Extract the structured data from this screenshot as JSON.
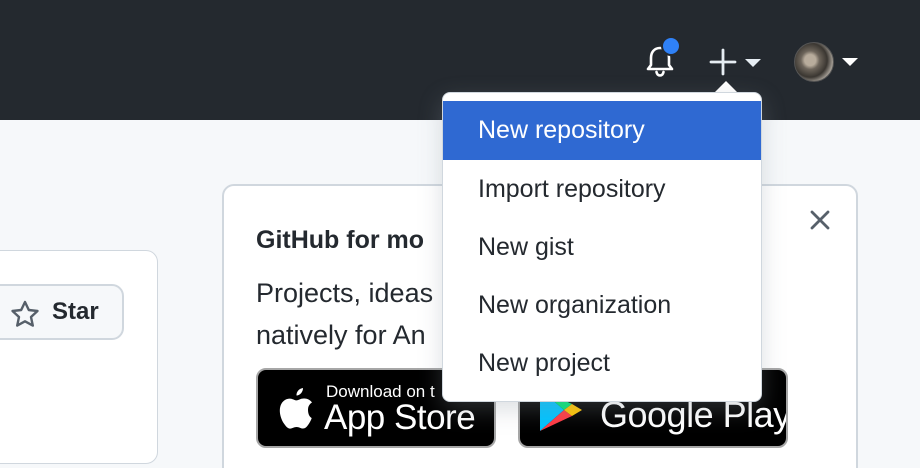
{
  "header": {
    "notifications_icon": "bell-icon",
    "create_icon": "plus-icon",
    "accent_unread_dot": "#2f81f7",
    "background": "#24292f"
  },
  "repo_card": {
    "star_label": "Star",
    "star_icon": "star-icon"
  },
  "mobile_card": {
    "title": "GitHub for mo",
    "description": "Projects, ideas natively for An",
    "app_store": {
      "small_text": "Download on t",
      "large_text": "App Store",
      "icon": "apple-icon"
    },
    "google_play": {
      "large_text": "Google Play",
      "icon": "play-icon"
    },
    "close_icon": "close-icon"
  },
  "create_menu": {
    "active_color": "#2f69d2",
    "items": [
      {
        "label": "New repository",
        "active": true
      },
      {
        "label": "Import repository",
        "active": false
      },
      {
        "label": "New gist",
        "active": false
      },
      {
        "label": "New organization",
        "active": false
      },
      {
        "label": "New project",
        "active": false
      }
    ]
  }
}
